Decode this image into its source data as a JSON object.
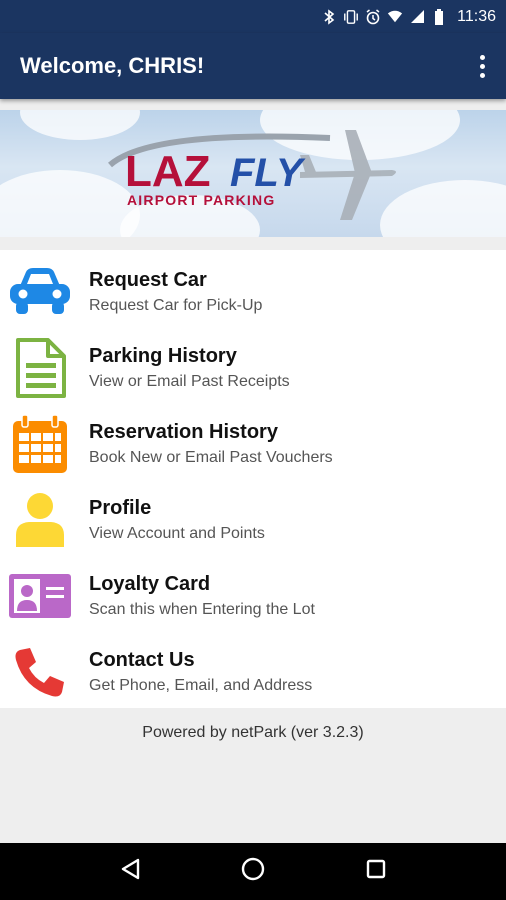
{
  "status_bar": {
    "time": "11:36"
  },
  "app_bar": {
    "title": "Welcome, CHRIS!"
  },
  "banner": {
    "logo_main": "LAZ",
    "logo_fly": "FLY",
    "logo_sub": "AIRPORT PARKING"
  },
  "menu": [
    {
      "title": "Request Car",
      "subtitle": "Request Car for Pick-Up",
      "icon": "car-icon",
      "color": "#1e88e5"
    },
    {
      "title": "Parking History",
      "subtitle": "View or Email Past Receipts",
      "icon": "document-icon",
      "color": "#7cb342"
    },
    {
      "title": "Reservation History",
      "subtitle": "Book New or Email Past Vouchers",
      "icon": "calendar-icon",
      "color": "#fb8c00"
    },
    {
      "title": "Profile",
      "subtitle": "View Account and Points",
      "icon": "person-icon",
      "color": "#fdd835"
    },
    {
      "title": "Loyalty Card",
      "subtitle": "Scan this when Entering the Lot",
      "icon": "id-card-icon",
      "color": "#ba68c8"
    },
    {
      "title": "Contact Us",
      "subtitle": "Get Phone, Email, and Address",
      "icon": "phone-icon",
      "color": "#e53935"
    }
  ],
  "footer": {
    "powered_by": "Powered by netPark (ver 3.2.3)"
  },
  "colors": {
    "app_bar": "#1b3561",
    "logo_red": "#b5103a",
    "logo_blue": "#2450a8"
  }
}
